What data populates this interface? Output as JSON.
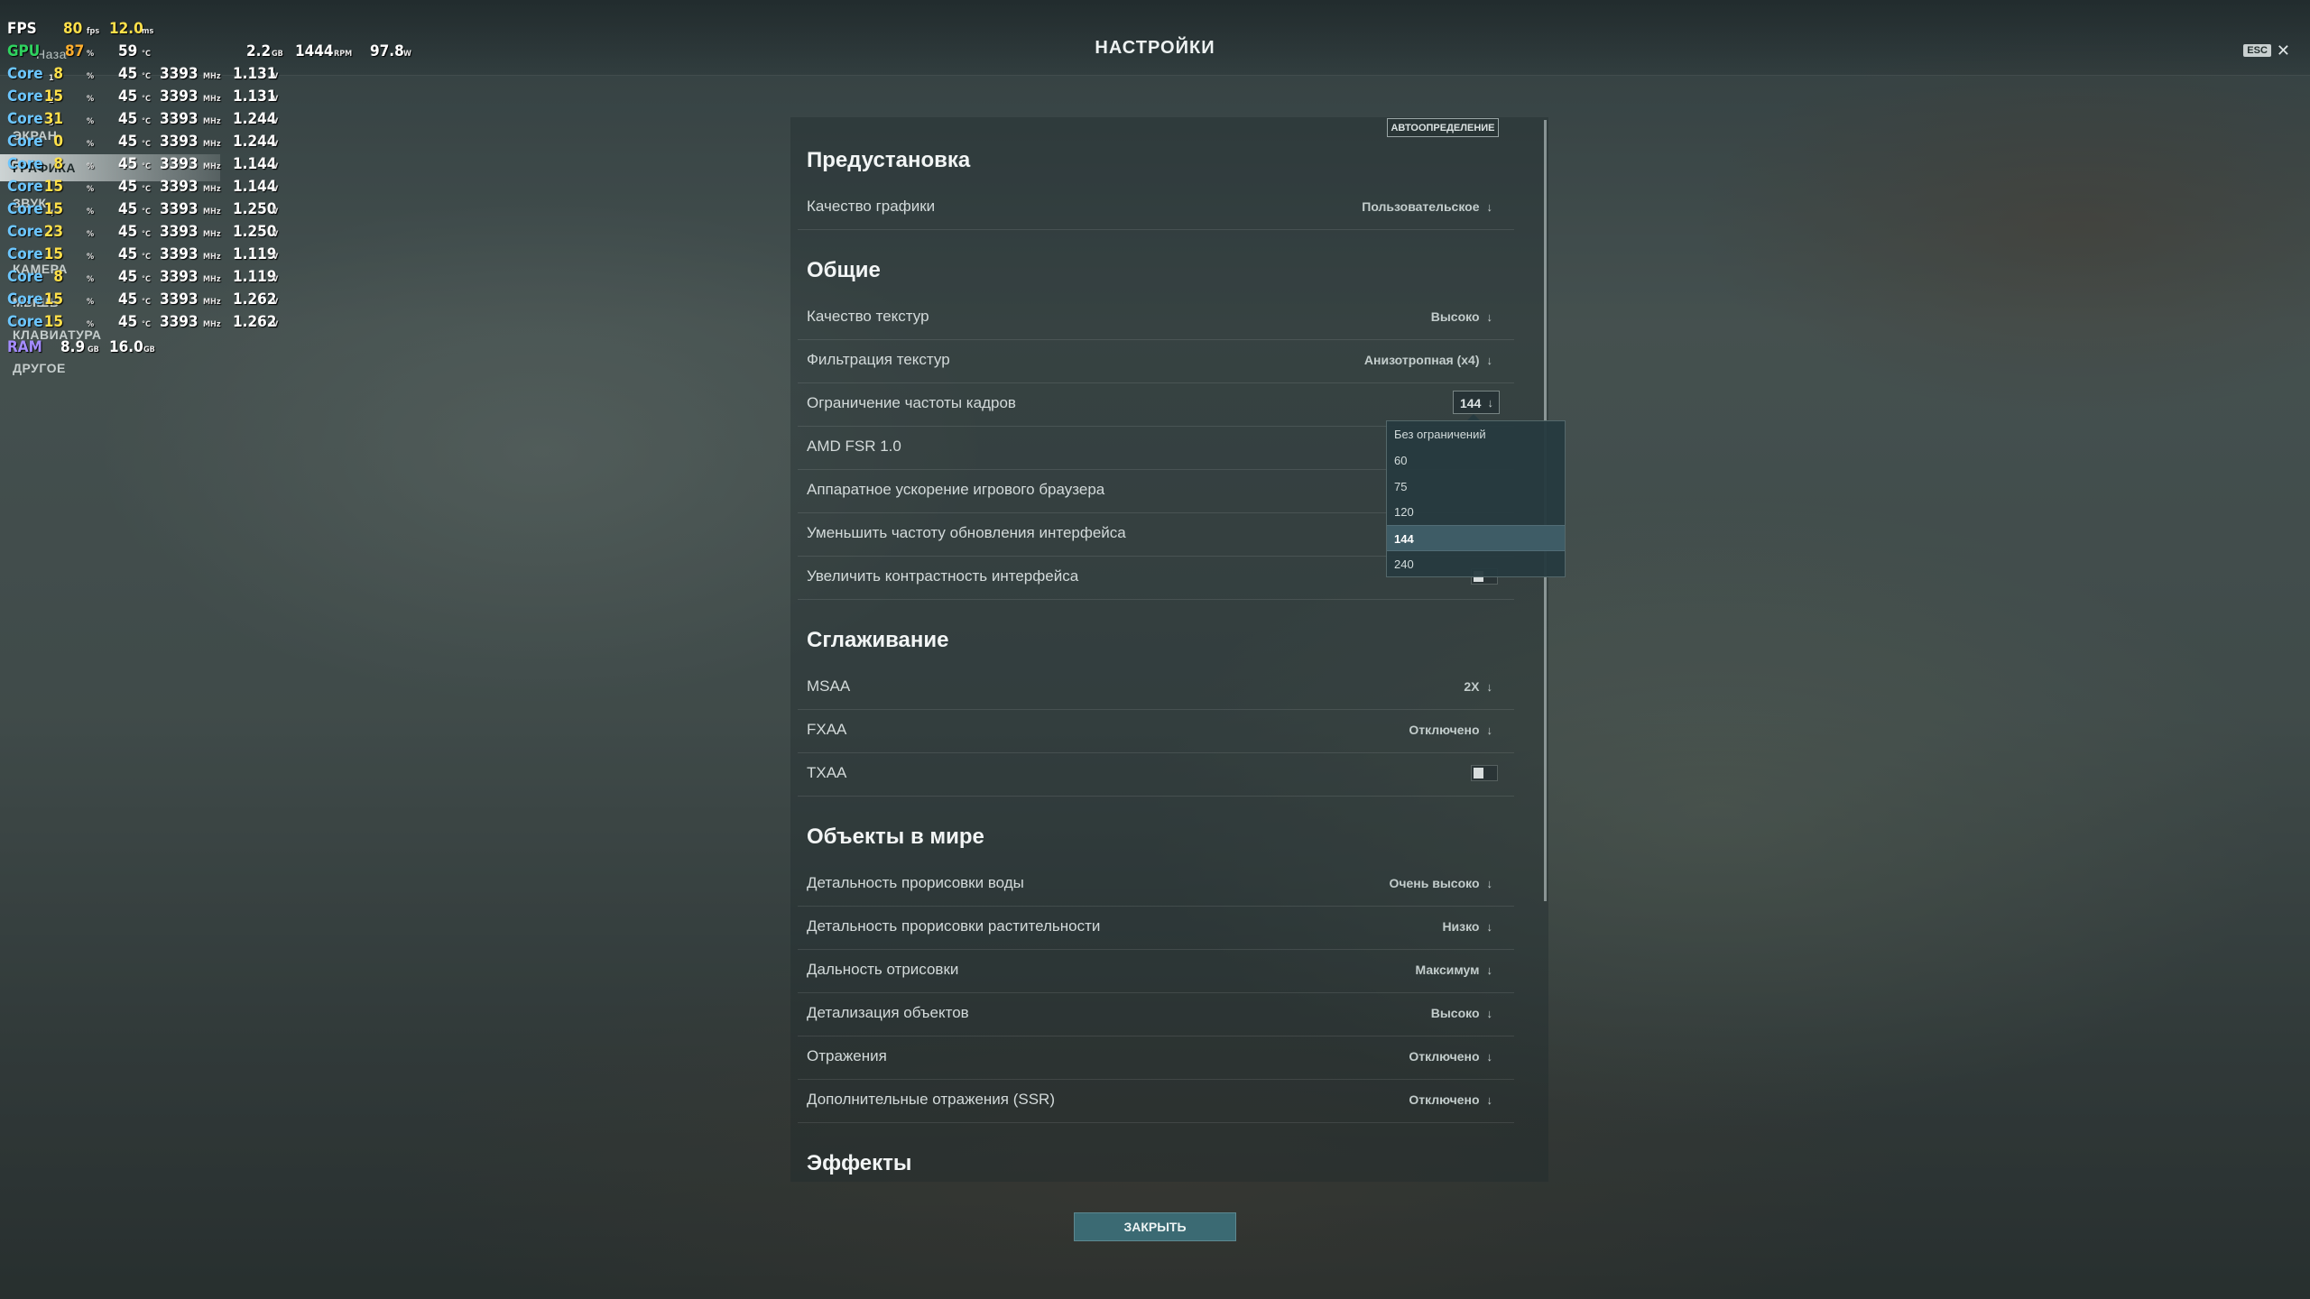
{
  "window": {
    "title": "НАСТРОЙКИ",
    "esc_label": "ESC",
    "close_symbol": "✕"
  },
  "side_nav": {
    "back_label": "Наза",
    "items": [
      {
        "label": "ЭКРАН"
      },
      {
        "label": "ГРАФИКА",
        "active": true
      },
      {
        "label": "ЗВУК"
      },
      {
        "label": "КАМЕРА"
      },
      {
        "label": "МЫШЬ"
      },
      {
        "label": "КЛАВИАТУРА"
      },
      {
        "label": "ДРУГОЕ"
      }
    ]
  },
  "settings": {
    "auto_detect_label": "АВТООПРЕДЕЛЕНИЕ",
    "sections": {
      "preset": {
        "title": "Предустановка",
        "rows": [
          {
            "label": "Качество графики",
            "value": "Пользовательское"
          }
        ]
      },
      "general": {
        "title": "Общие",
        "rows": [
          {
            "label": "Качество текстур",
            "value": "Высоко"
          },
          {
            "label": "Фильтрация текстур",
            "value": "Анизотропная (x4)"
          },
          {
            "label": "Ограничение частоты кадров",
            "value": "144"
          },
          {
            "label": "AMD FSR 1.0"
          },
          {
            "label": "Аппаратное ускорение игрового браузера"
          },
          {
            "label": "Уменьшить частоту обновления интерфейса"
          },
          {
            "label": "Увеличить контрастность интерфейса"
          }
        ]
      },
      "antialiasing": {
        "title": "Сглаживание",
        "rows": [
          {
            "label": "MSAA",
            "value": "2X"
          },
          {
            "label": "FXAA",
            "value": "Отключено"
          },
          {
            "label": "TXAA",
            "toggle": false
          }
        ]
      },
      "world": {
        "title": "Объекты в мире",
        "rows": [
          {
            "label": "Детальность прорисовки воды",
            "value": "Очень высоко"
          },
          {
            "label": "Детальность прорисовки растительности",
            "value": "Низко"
          },
          {
            "label": "Дальность отрисовки",
            "value": "Максимум"
          },
          {
            "label": "Детализация объектов",
            "value": "Высоко"
          },
          {
            "label": "Отражения",
            "value": "Отключено"
          },
          {
            "label": "Дополнительные отражения (SSR)",
            "value": "Отключено"
          }
        ]
      },
      "effects": {
        "title": "Эффекты"
      }
    },
    "fps_dropdown": {
      "selected": "144",
      "options": [
        "Без ограничений",
        "60",
        "75",
        "120",
        "144",
        "240"
      ]
    },
    "close_button_label": "ЗАКРЫТЬ"
  },
  "perf_overlay": {
    "fps": {
      "label": "FPS",
      "value": "80",
      "unit": "fps",
      "frametime": "12.0",
      "frametime_unit": "ms"
    },
    "gpu": {
      "label": "GPU",
      "load": "87",
      "load_unit": "%",
      "temp": "59",
      "temp_unit": "°C",
      "vram": "2.2",
      "vram_unit": "GB",
      "fan": "1444",
      "fan_unit": "RPM",
      "power": "97.8",
      "power_unit": "W"
    },
    "cores": [
      {
        "label": "Core",
        "idx": "1",
        "load": "8",
        "temp": "45",
        "clock": "3393",
        "volt": "1.131"
      },
      {
        "label": "Core",
        "idx": "2",
        "load": "15",
        "temp": "45",
        "clock": "3393",
        "volt": "1.131"
      },
      {
        "label": "Core",
        "idx": "3",
        "load": "31",
        "temp": "45",
        "clock": "3393",
        "volt": "1.244"
      },
      {
        "label": "Core",
        "idx": "",
        "load": "0",
        "temp": "45",
        "clock": "3393",
        "volt": "1.244"
      },
      {
        "label": "Core",
        "idx": "",
        "load": "8",
        "temp": "45",
        "clock": "3393",
        "volt": "1.144"
      },
      {
        "label": "Core",
        "idx": "",
        "load": "15",
        "temp": "45",
        "clock": "3393",
        "volt": "1.144"
      },
      {
        "label": "Core",
        "idx": "4",
        "load": "15",
        "temp": "45",
        "clock": "3393",
        "volt": "1.250"
      },
      {
        "label": "Core",
        "idx": "",
        "load": "23",
        "temp": "45",
        "clock": "3393",
        "volt": "1.250"
      },
      {
        "label": "Core",
        "idx": "",
        "load": "15",
        "temp": "45",
        "clock": "3393",
        "volt": "1.119"
      },
      {
        "label": "Core",
        "idx": "",
        "load": "8",
        "temp": "45",
        "clock": "3393",
        "volt": "1.119"
      },
      {
        "label": "Core",
        "idx": "",
        "load": "15",
        "temp": "45",
        "clock": "3393",
        "volt": "1.262"
      },
      {
        "label": "Core",
        "idx": "",
        "load": "15",
        "temp": "45",
        "clock": "3393",
        "volt": "1.262"
      }
    ],
    "units": {
      "load": "%",
      "temp": "°C",
      "clock": "MHz",
      "volt": "V"
    },
    "ram": {
      "label": "RAM",
      "used": "8.9",
      "used_unit": "GB",
      "total": "16.0",
      "total_unit": "GB"
    }
  }
}
